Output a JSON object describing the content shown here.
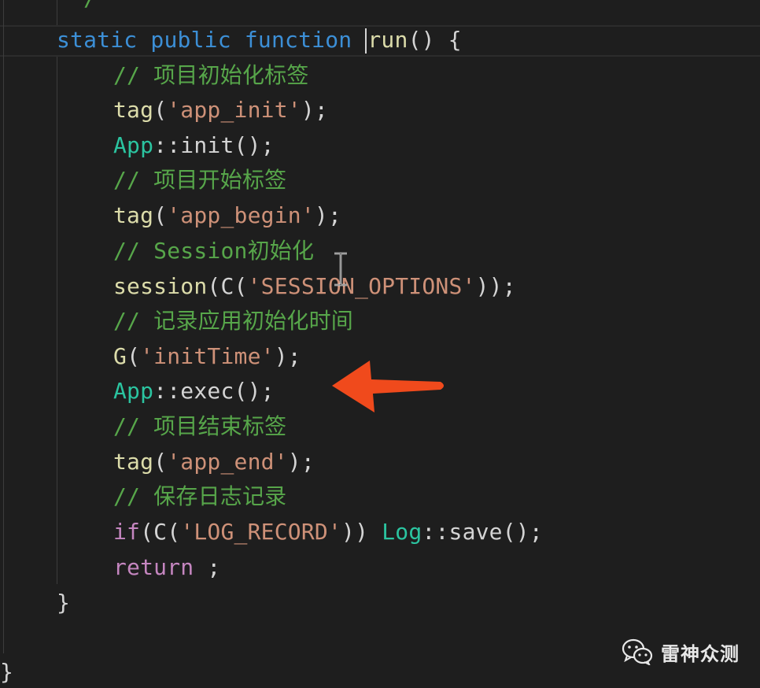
{
  "code": {
    "lines": {
      "l0": {
        "text": " */"
      },
      "l1": {
        "kw1": "static",
        "kw2": "public",
        "kw3": "function",
        "name": "run",
        "rest": "() {"
      },
      "l2": {
        "text": "// 项目初始化标签"
      },
      "l3": {
        "fn": "tag",
        "p1": "(",
        "str": "'app_init'",
        "p2": ");"
      },
      "l4": {
        "cls": "App",
        "rest": "::init();"
      },
      "l5": {
        "text": "// 项目开始标签"
      },
      "l6": {
        "fn": "tag",
        "p1": "(",
        "str": "'app_begin'",
        "p2": ");"
      },
      "l7": {
        "text": "// Session初始化"
      },
      "l8": {
        "fn": "session",
        "p1": "(C(",
        "str": "'SESSION_OPTIONS'",
        "p2": "));"
      },
      "l9": {
        "text": "// 记录应用初始化时间"
      },
      "l10": {
        "fn": "G",
        "p1": "(",
        "str": "'initTime'",
        "p2": ");"
      },
      "l11": {
        "cls": "App",
        "rest": "::exec();"
      },
      "l12": {
        "text": "// 项目结束标签"
      },
      "l13": {
        "fn": "tag",
        "p1": "(",
        "str": "'app_end'",
        "p2": ");"
      },
      "l14": {
        "text": "// 保存日志记录"
      },
      "l15": {
        "ctl": "if",
        "p1": "(C(",
        "str": "'LOG_RECORD'",
        "p2": ")) ",
        "cls": "Log",
        "rest": "::save();"
      },
      "l16": {
        "ctl": "return",
        "rest": " ;"
      },
      "l17": {
        "text": "}"
      },
      "l18": {
        "text": "}"
      }
    }
  },
  "watermark": {
    "text": "雷神众测"
  },
  "colors": {
    "background": "#1e1e1e",
    "keyword": "#3c8fd6",
    "comment": "#57a64a",
    "string": "#ce9178",
    "class": "#2bc4a0",
    "arrow": "#f04a1c"
  },
  "icons": {
    "annotation": "red-arrow-icon",
    "cursor": "text-ibeam-cursor-icon",
    "watermark": "wechat-icon"
  }
}
